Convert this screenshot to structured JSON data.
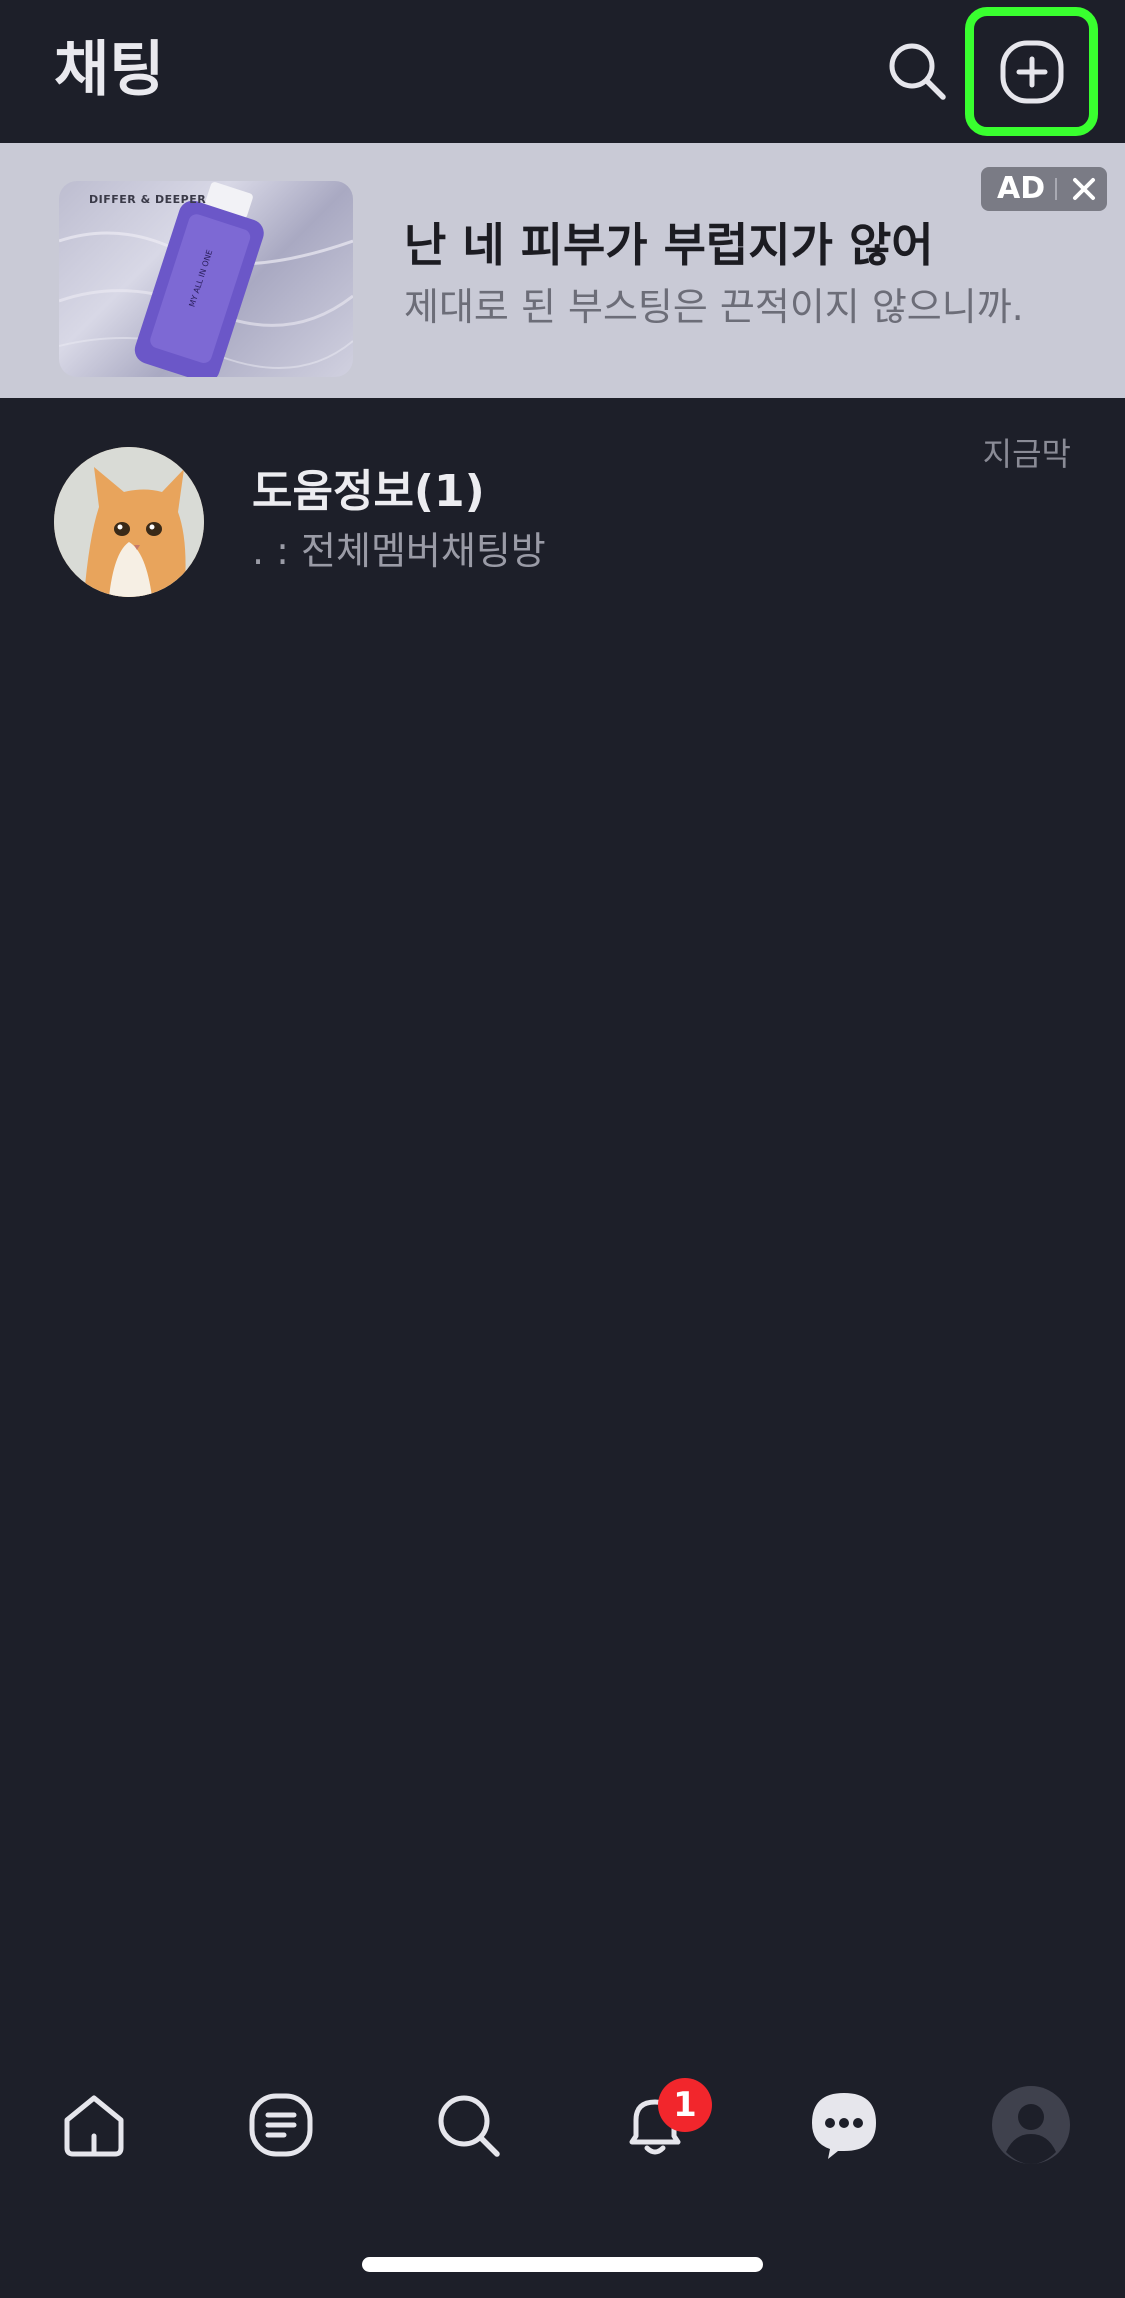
{
  "header": {
    "title": "채팅"
  },
  "ad": {
    "brand": "DIFFER & DEEPER",
    "headline": "난 네 피부가 부럽지가 않어",
    "subtext": "제대로 된 부스팅은 끈적이지 않으니까.",
    "badge_label": "AD"
  },
  "chats": [
    {
      "name": "도움정보(1)",
      "preview": ". : 전체멤버채팅방",
      "time": "지금막"
    }
  ],
  "nav": {
    "notification_count": "1"
  },
  "colors": {
    "background": "#1d1f29",
    "ad_background": "#c9cad6",
    "highlight": "#39ff2f",
    "badge": "#f2262c"
  }
}
